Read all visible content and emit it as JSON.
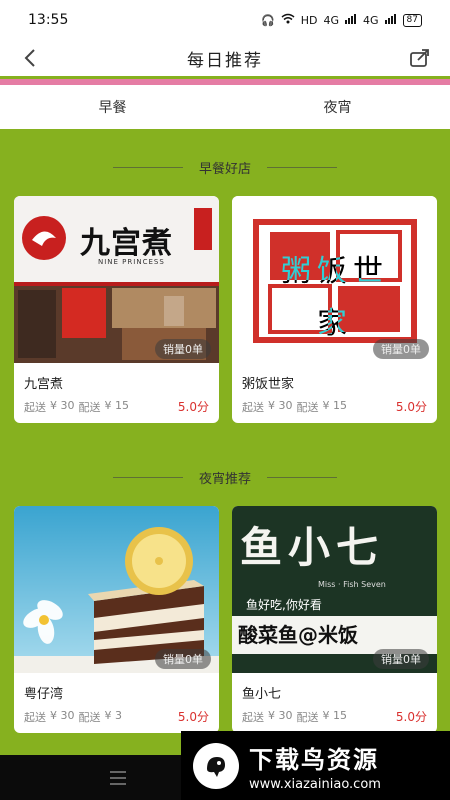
{
  "status_bar": {
    "time": "13:55",
    "network": "HD",
    "signal1": "4G",
    "signal2": "4G",
    "battery": "87"
  },
  "header": {
    "title": "每日推荐",
    "back_icon": "back-arrow-icon",
    "share_icon": "share-icon"
  },
  "tabs": [
    {
      "label": "早餐"
    },
    {
      "label": "夜宵"
    }
  ],
  "sections": [
    {
      "title": "早餐好店",
      "cards": [
        {
          "name": "九宫煮",
          "sales": "销量0单",
          "start_label": "起送",
          "start_price": "¥ 30",
          "delivery_label": "配送",
          "delivery_price": "¥ 15",
          "score": "5.0分",
          "image_text": "九宫煮",
          "image_subtext": "NINE PRINCESS"
        },
        {
          "name": "粥饭世家",
          "sales": "销量0单",
          "start_label": "起送",
          "start_price": "¥ 30",
          "delivery_label": "配送",
          "delivery_price": "¥ 15",
          "score": "5.0分",
          "image_text": "粥饭世家"
        }
      ]
    },
    {
      "title": "夜宵推荐",
      "cards": [
        {
          "name": "粤仔湾",
          "sales": "销量0单",
          "start_label": "起送",
          "start_price": "¥ 30",
          "delivery_label": "配送",
          "delivery_price": "¥ 3",
          "score": "5.0分"
        },
        {
          "name": "鱼小七",
          "sales": "销量0单",
          "start_label": "起送",
          "start_price": "¥ 30",
          "delivery_label": "配送",
          "delivery_price": "¥ 15",
          "score": "5.0分",
          "image_text": "鱼小七",
          "image_subtext": "Miss · Fish Seven",
          "image_slogan": "鱼好吃,你好看",
          "image_banner": "酸菜鱼@米饭"
        }
      ]
    }
  ],
  "promo": {
    "title": "下载鸟资源",
    "url": "www.xiazainiao.com"
  },
  "colors": {
    "background": "#86b11f",
    "accent": "#e57ca4",
    "score": "#d9312f"
  }
}
